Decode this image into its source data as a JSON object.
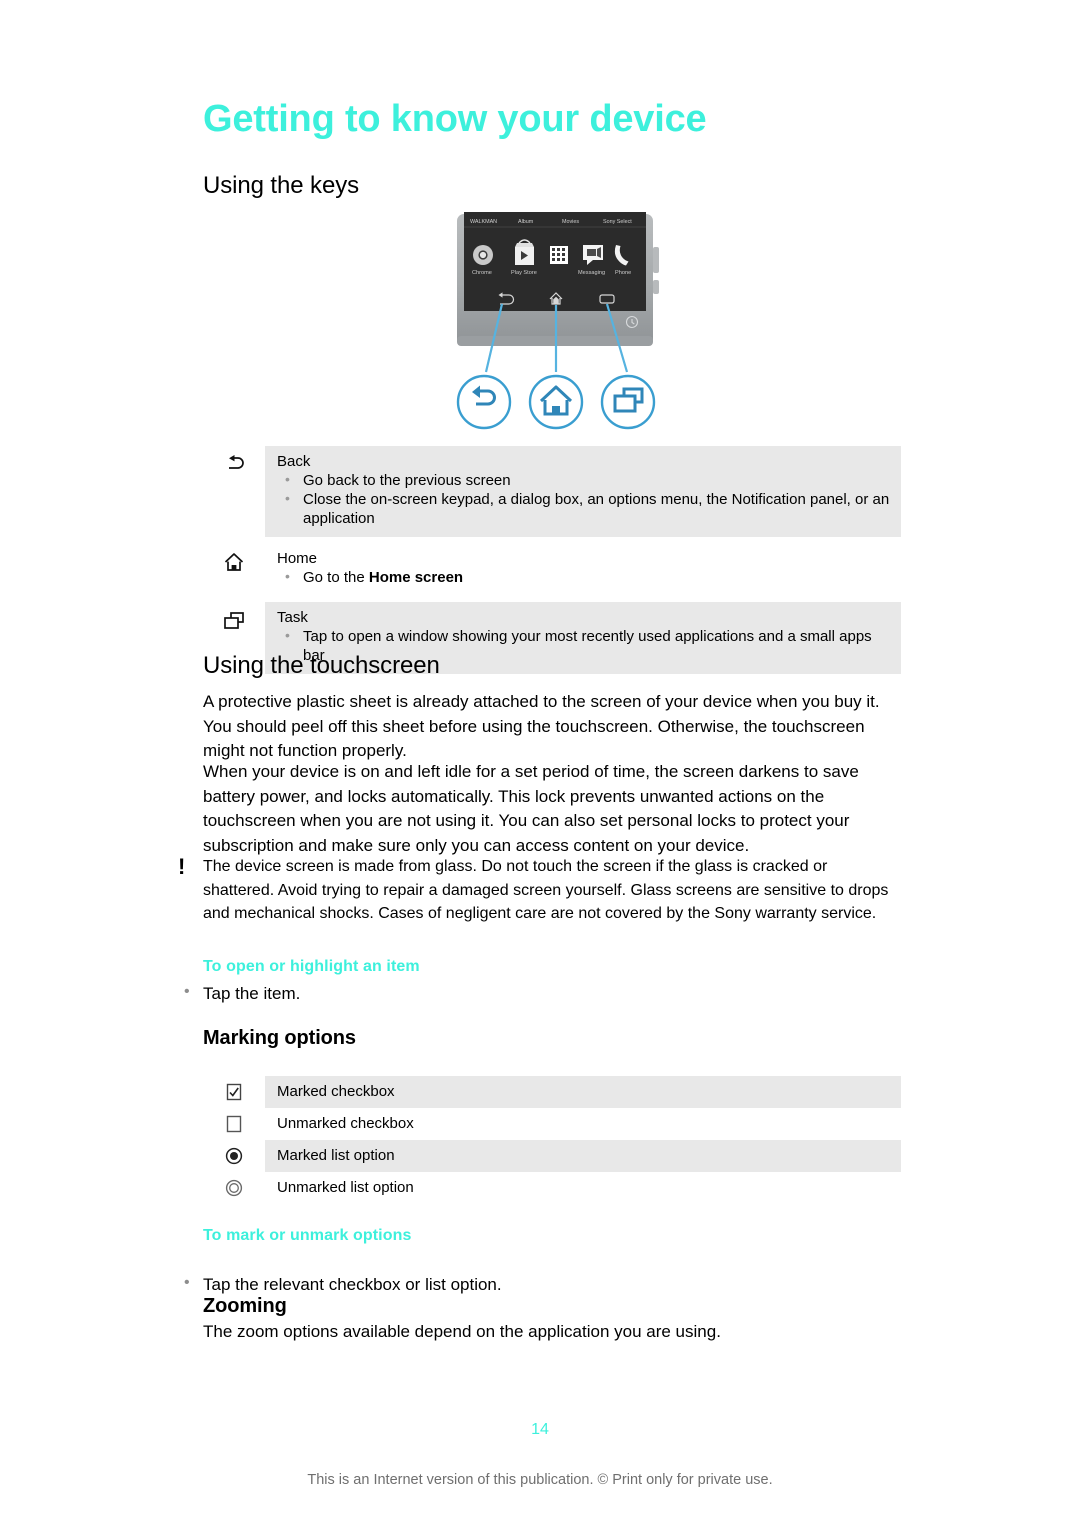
{
  "document": {
    "title": "Getting to know your device",
    "page_number": "14",
    "footer": "This is an Internet version of this publication. © Print only for private use.",
    "accent_color": "#3DF0DC",
    "table_shade_color": "#E8E8E8"
  },
  "sections": {
    "using_keys": {
      "heading": "Using the keys"
    },
    "using_touchscreen": {
      "heading": "Using the touchscreen",
      "paragraph_1": "A protective plastic sheet is already attached to the screen of your device when you buy it. You should peel off this sheet before using the touchscreen. Otherwise, the touchscreen might not function properly.",
      "paragraph_2": "When your device is on and left idle for a set period of time, the screen darkens to save battery power, and locks automatically. This lock prevents unwanted actions on the touchscreen when you are not using it. You can also set personal locks to protect your subscription and make sure only you can access content on your device."
    },
    "warning": {
      "marker": "!",
      "text": "The device screen is made from glass. Do not touch the screen if the glass is cracked or shattered. Avoid trying to repair a damaged screen yourself. Glass screens are sensitive to drops and mechanical shocks. Cases of negligent care are not covered by the Sony warranty service."
    },
    "open_highlight": {
      "heading": "To open or highlight an item",
      "bullet": "Tap the item."
    },
    "marking_options": {
      "heading": "Marking options"
    },
    "mark_unmark": {
      "heading": "To mark or unmark options",
      "bullet": "Tap the relevant checkbox or list option."
    },
    "zooming": {
      "heading": "Zooming",
      "paragraph": "The zoom options available depend on the application you are using."
    }
  },
  "device_illustration": {
    "app_row_top": [
      "WALKMAN",
      "Album",
      "Movies",
      "Sony Select"
    ],
    "app_row_icons": [
      {
        "label": "Chrome",
        "icon": "chrome-icon"
      },
      {
        "label": "Play Store",
        "icon": "play-store-icon"
      },
      {
        "label": "",
        "icon": "app-grid-icon"
      },
      {
        "label": "Messaging",
        "icon": "messaging-icon"
      },
      {
        "label": "Phone",
        "icon": "phone-icon"
      }
    ],
    "callout_icons": [
      {
        "name": "back-key-icon"
      },
      {
        "name": "home-key-icon"
      },
      {
        "name": "task-key-icon"
      }
    ],
    "callout_color": "#4CA6D9"
  },
  "key_table": {
    "rows": [
      {
        "icon": "back-key-icon",
        "title": "Back",
        "shaded": true,
        "bullets": [
          "Go back to the previous screen",
          "Close the on-screen keypad, a dialog box, an options menu, the Notification panel, or an application"
        ]
      },
      {
        "icon": "home-key-icon",
        "title": "Home",
        "shaded": false,
        "bullets_html": [
          "Go to the <b>Home screen</b>"
        ],
        "bullets": [
          "Go to the Home screen"
        ]
      },
      {
        "icon": "task-key-icon",
        "title": "Task",
        "shaded": true,
        "bullets": [
          "Tap to open a window showing your most recently used applications and a small apps bar"
        ]
      }
    ]
  },
  "marking_table": {
    "rows": [
      {
        "icon": "marked-checkbox-icon",
        "label": "Marked checkbox",
        "shaded": true
      },
      {
        "icon": "unmarked-checkbox-icon",
        "label": "Unmarked checkbox",
        "shaded": false
      },
      {
        "icon": "marked-radio-icon",
        "label": "Marked list option",
        "shaded": true
      },
      {
        "icon": "unmarked-radio-icon",
        "label": "Unmarked list option",
        "shaded": false
      }
    ]
  }
}
